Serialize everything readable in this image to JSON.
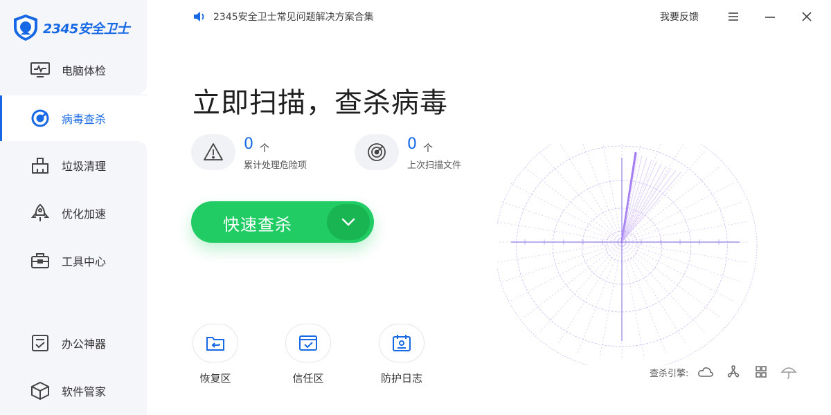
{
  "app": {
    "logo_text": "2345安全卫士",
    "notice": "2345安全卫士常见问题解决方案合集",
    "feedback": "我要反馈"
  },
  "sidebar": {
    "items": [
      {
        "label": "电脑体检",
        "icon": "monitor-icon",
        "active": false
      },
      {
        "label": "病毒查杀",
        "icon": "target-icon",
        "active": true
      },
      {
        "label": "垃圾清理",
        "icon": "cleaner-icon",
        "active": false
      },
      {
        "label": "优化加速",
        "icon": "rocket-icon",
        "active": false
      },
      {
        "label": "工具中心",
        "icon": "toolbox-icon",
        "active": false
      },
      {
        "label": "办公神器",
        "icon": "office-icon",
        "active": false
      },
      {
        "label": "软件管家",
        "icon": "box-icon",
        "active": false
      }
    ]
  },
  "main": {
    "headline": "立即扫描，查杀病毒",
    "stats": [
      {
        "number": "0",
        "unit": "个",
        "label": "累计处理危险项",
        "icon": "warning-icon"
      },
      {
        "number": "0",
        "unit": "个",
        "label": "上次扫描文件",
        "icon": "radar-icon"
      }
    ],
    "scan_button": "快速查杀",
    "tools": [
      {
        "label": "恢复区",
        "icon": "restore-folder-icon"
      },
      {
        "label": "信任区",
        "icon": "trust-icon"
      },
      {
        "label": "防护日志",
        "icon": "log-icon"
      }
    ],
    "engine_label": "查杀引擎:",
    "engine_icons": [
      "cloud-icon",
      "fan-icon",
      "grid-icon",
      "umbrella-icon"
    ]
  },
  "colors": {
    "brand_blue": "#1768e5",
    "scan_green": "#22cc64",
    "radar_purple": "#a680f0"
  }
}
